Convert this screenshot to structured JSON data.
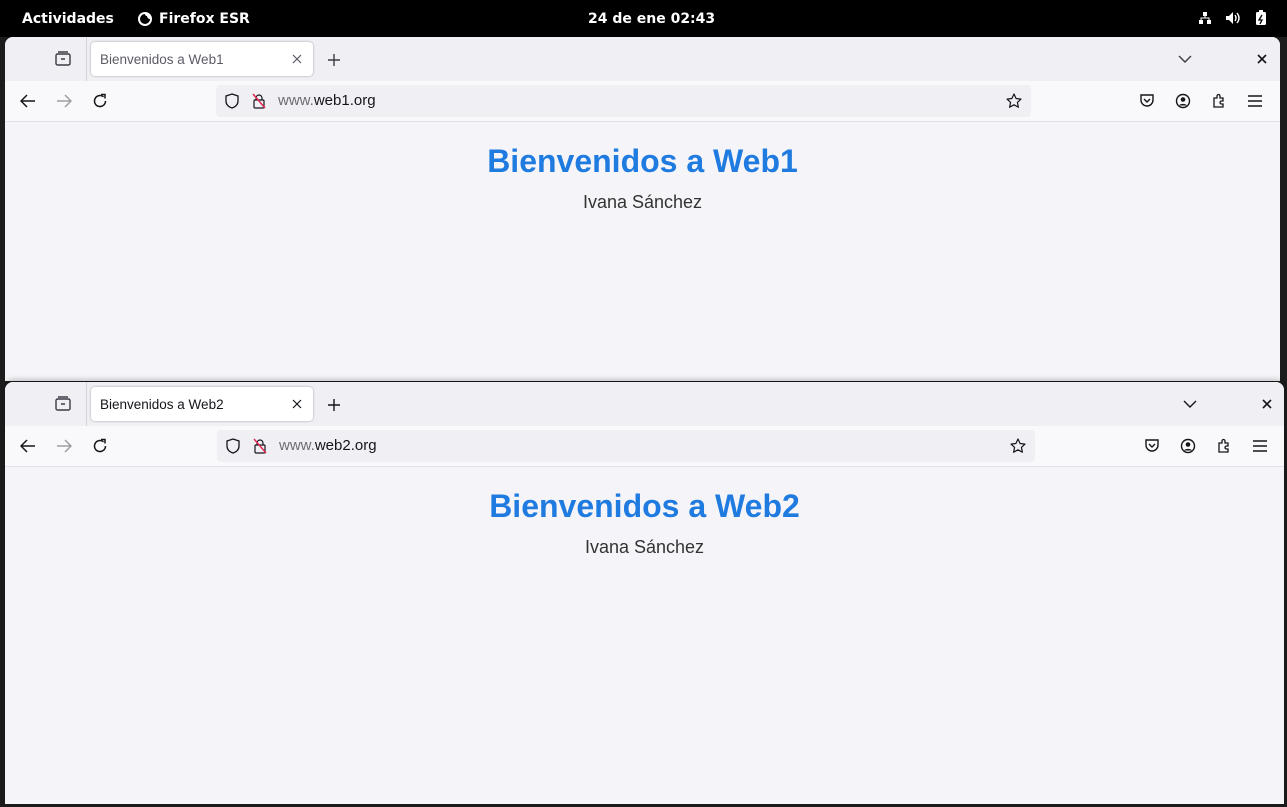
{
  "topbar": {
    "activities": "Actividades",
    "app_name": "Firefox ESR",
    "clock": "24 de ene  02:43",
    "tray_icons": [
      "network-icon",
      "volume-icon",
      "battery-icon"
    ]
  },
  "windows": [
    {
      "tab_title": "Bienvenidos a Web1",
      "url_prefix": "www.",
      "url_domain": "web1.org",
      "heading": "Bienvenidos a Web1",
      "author": "Ivana Sánchez"
    },
    {
      "tab_title": "Bienvenidos a Web2",
      "url_prefix": "www.",
      "url_domain": "web2.org",
      "heading": "Bienvenidos a Web2",
      "author": "Ivana Sánchez"
    }
  ],
  "colors": {
    "heading": "#1f7be0",
    "topbar_bg": "#000000",
    "tabbar_bg": "#f0f0f4",
    "content_bg": "#f5f5f9"
  }
}
